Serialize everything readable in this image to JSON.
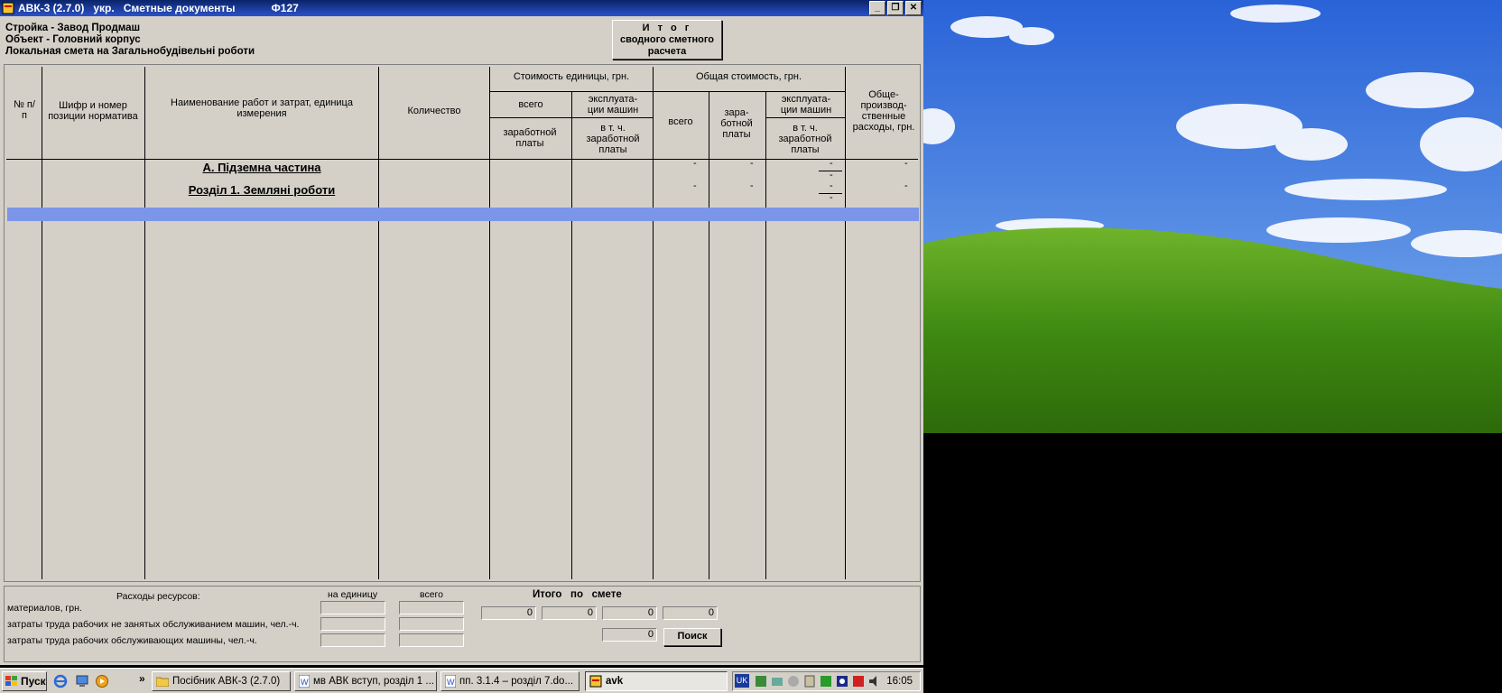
{
  "window": {
    "title_parts": [
      "АВК-3 (2.7.0)",
      "укр.",
      "Сметные документы",
      "Ф127"
    ],
    "controls": {
      "minimize": "_",
      "restore": "❐",
      "close": "✕"
    }
  },
  "header": {
    "lines": [
      "Стройка - Завод Продмаш",
      "Объект - Головний корпус",
      "Локальная смета на Загальнобудівельні роботи"
    ],
    "itog_button": [
      "И т о г",
      "сводного сметного",
      "расчета"
    ]
  },
  "grid": {
    "columns": {
      "num": "№ п/п",
      "code": "Шифр и номер позиции норматива",
      "name": "Наименование работ и затрат, единица измерения",
      "qty": "Количество",
      "unit_cost_group": "Стоимость единицы, грн.",
      "unit_total": "всего",
      "unit_machines": "эксплуата-ции машин",
      "unit_wage": "заработной платы",
      "unit_wage_incl": "в т. ч. заработной платы",
      "total_cost_group": "Общая стоимость, грн.",
      "total_all": "всего",
      "total_wage": "зара-ботной платы",
      "total_machines": "эксплуата-ции машин",
      "total_wage_incl": "в т. ч. заработной платы",
      "overhead": "Обще-производ-ственные расходы, грн."
    },
    "sections": [
      {
        "title": "А.   Підземна частина",
        "values": [
          "-",
          "-",
          "-",
          "-",
          "-"
        ]
      },
      {
        "title": "Розділ 1. Земляні роботи",
        "values": [
          "-",
          "-",
          "-",
          "-",
          "-"
        ]
      }
    ]
  },
  "bottom": {
    "resources_title": "Расходы ресурсов:",
    "per_unit_label": "на единицу",
    "total_label": "всего",
    "rows": [
      "материалов, грн.",
      "затраты труда рабочих не занятых обслуживанием машин, чел.-ч.",
      "затраты труда рабочих обслуживающих машины, чел.-ч."
    ],
    "itogo_title": "Итого   по   смете",
    "itogo_values": [
      "0",
      "0",
      "0",
      "0"
    ],
    "extra_value": "0",
    "search_label": "Поиск"
  },
  "taskbar": {
    "start_label": "Пуск",
    "chevron": "»",
    "tasks": [
      {
        "label": "Посібник АВК-3 (2.7.0)",
        "icon": "folder-icon"
      },
      {
        "label": "мв АВК вступ, розділ 1 ...",
        "icon": "word-icon"
      },
      {
        "label": "пп. 3.1.4 – розділ 7.do...",
        "icon": "word-icon"
      },
      {
        "label": "avk",
        "icon": "avk-icon",
        "active": true
      }
    ],
    "tray": {
      "lang": "UK",
      "clock": "16:05"
    }
  }
}
